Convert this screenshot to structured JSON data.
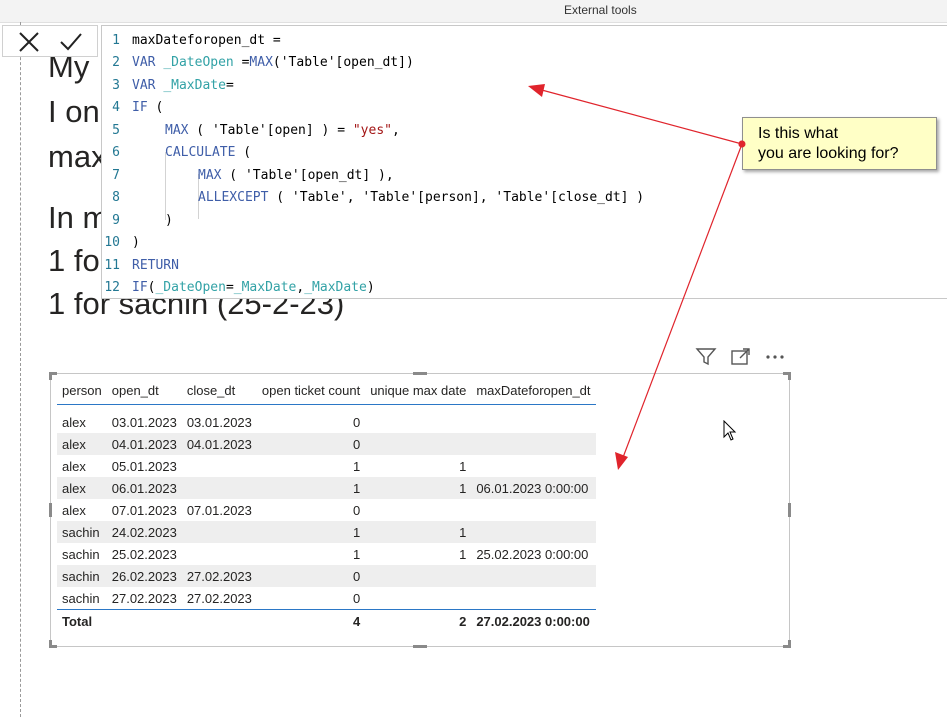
{
  "toolbar": {
    "external_tools_label": "External tools"
  },
  "background_text": {
    "line1": "My",
    "line2": "I on",
    "line3": "max",
    "line4": "In m",
    "line5": "1 fo",
    "line6": "1 for sachin (25-2-23)"
  },
  "formula_bar": {
    "cancel_icon": "close-icon",
    "commit_icon": "check-icon",
    "line_numbers": [
      "1",
      "2",
      "3",
      "4",
      "5",
      "6",
      "7",
      "8",
      "9",
      "10",
      "11",
      "12"
    ],
    "lines": [
      {
        "p1": "maxDateforopen_dt ="
      },
      {
        "p1": "VAR ",
        "p2": "_DateOpen",
        "p3": " =",
        "p4": "MAX",
        "p5": "('Table'[open_dt])"
      },
      {
        "p1": "VAR ",
        "p2": "_MaxDate",
        "p3": "="
      },
      {
        "p1": "IF",
        "p2": " ("
      },
      {
        "p1": "MAX",
        "p2": " ( 'Table'[open] ) = ",
        "p3": "\"yes\"",
        "p4": ","
      },
      {
        "p1": "CALCULATE",
        "p2": " ("
      },
      {
        "p1": "MAX",
        "p2": " ( 'Table'[open_dt] ),"
      },
      {
        "p1": "ALLEXCEPT",
        "p2": " ( 'Table', 'Table'[person], 'Table'[close_dt] )"
      },
      {
        "p1": ")"
      },
      {
        "p1": ")"
      },
      {
        "p1": "RETURN"
      },
      {
        "p1": "IF",
        "p2": "(",
        "p3": "_DateOpen",
        "p4": "=",
        "p5": "_MaxDate",
        "p6": ",",
        "p7": "_MaxDate",
        "p8": ")"
      }
    ]
  },
  "visual_header": {
    "filter_icon": "filter-icon",
    "focus_icon": "focus-mode-icon",
    "more_icon": "more-options-icon"
  },
  "table": {
    "columns": [
      "person",
      "open_dt",
      "close_dt",
      "open ticket count",
      "unique max date",
      "maxDateforopen_dt"
    ],
    "rows": [
      [
        "alex",
        "03.01.2023",
        "03.01.2023",
        "0",
        "",
        ""
      ],
      [
        "alex",
        "04.01.2023",
        "04.01.2023",
        "0",
        "",
        ""
      ],
      [
        "alex",
        "05.01.2023",
        "",
        "1",
        "1",
        ""
      ],
      [
        "alex",
        "06.01.2023",
        "",
        "1",
        "1",
        "06.01.2023 0:00:00"
      ],
      [
        "alex",
        "07.01.2023",
        "07.01.2023",
        "0",
        "",
        ""
      ],
      [
        "sachin",
        "24.02.2023",
        "",
        "1",
        "1",
        ""
      ],
      [
        "sachin",
        "25.02.2023",
        "",
        "1",
        "1",
        "25.02.2023 0:00:00"
      ],
      [
        "sachin",
        "26.02.2023",
        "27.02.2023",
        "0",
        "",
        ""
      ],
      [
        "sachin",
        "27.02.2023",
        "27.02.2023",
        "0",
        "",
        ""
      ]
    ],
    "total": [
      "Total",
      "",
      "",
      "4",
      "2",
      "27.02.2023 0:00:00"
    ]
  },
  "callout": {
    "line1": "Is this what",
    "line2": "you are looking for?"
  },
  "colors": {
    "keyword": "#3f5ea8",
    "variable": "#32a2a6",
    "string": "#a31515",
    "line_number": "#237893",
    "arrow": "#e0242c",
    "callout_bg": "#ffffc6",
    "header_rule": "#2b77c6"
  }
}
